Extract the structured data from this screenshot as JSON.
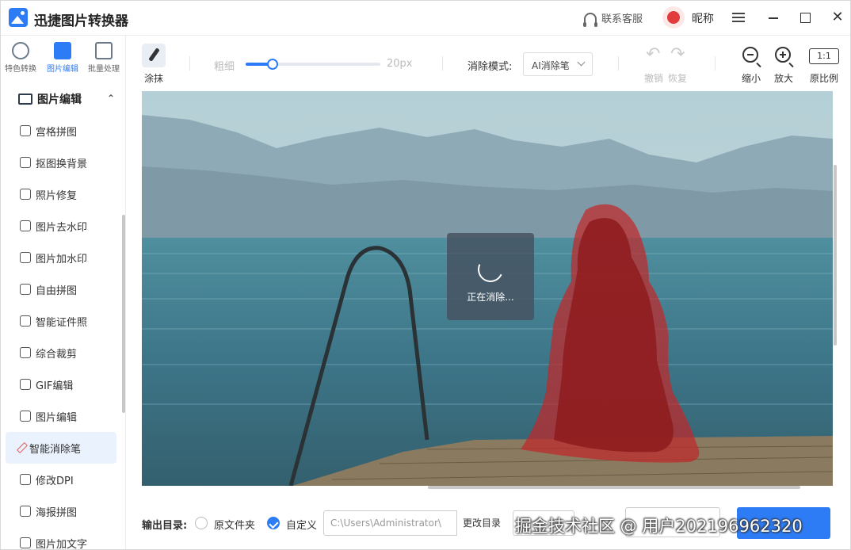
{
  "app": {
    "title": "迅捷图片转换器"
  },
  "header": {
    "support": "联系客服",
    "nickname": "昵称",
    "close": "✕"
  },
  "topnav": [
    {
      "label": "特色转换",
      "icon": "swap-icon"
    },
    {
      "label": "图片编辑",
      "icon": "image-edit-icon"
    },
    {
      "label": "批量处理",
      "icon": "batch-icon"
    }
  ],
  "sidebar": {
    "section": "图片编辑",
    "chevron": "⌃",
    "items": [
      {
        "label": "宫格拼图"
      },
      {
        "label": "抠图换背景"
      },
      {
        "label": "照片修复"
      },
      {
        "label": "图片去水印"
      },
      {
        "label": "图片加水印"
      },
      {
        "label": "自由拼图"
      },
      {
        "label": "智能证件照"
      },
      {
        "label": "综合裁剪"
      },
      {
        "label": "GIF编辑"
      },
      {
        "label": "图片编辑"
      },
      {
        "label": "智能消除笔"
      },
      {
        "label": "修改DPI"
      },
      {
        "label": "海报拼图"
      },
      {
        "label": "图片加文字"
      }
    ],
    "active_index": 10
  },
  "toolbar": {
    "brush_label": "涂抹",
    "thickness_label": "粗细",
    "thickness_value": "20px",
    "thickness_level": 0.2,
    "mode_label": "消除模式:",
    "mode_value": "AI消除笔",
    "undo_symbol": "↶",
    "redo_symbol": "↷",
    "undo_label": "撤销",
    "redo_label": "恢复",
    "zoom_out_label": "缩小",
    "zoom_in_label": "放大",
    "ratio_box": "1:1",
    "ratio_label": "原比例"
  },
  "canvas": {
    "loading_text": "正在消除..."
  },
  "bottom": {
    "output_label": "输出目录:",
    "option_original": "原文件夹",
    "option_custom": "自定义",
    "selected": "custom",
    "path_value": "C:\\Users\\Administrator\\",
    "change_dir": "更改目录"
  },
  "watermark": "掘金技术社区 @ 用户202196962320",
  "colors": {
    "accent": "#2d7cf6",
    "mask": "#c0282a"
  }
}
